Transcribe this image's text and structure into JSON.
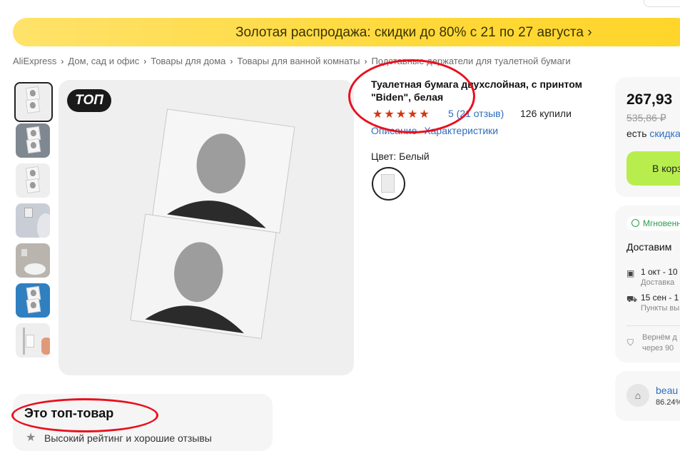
{
  "banner": {
    "text": "Золотая распродажа: скидки до 80% с 21 по 27 августа ›"
  },
  "breadcrumbs": [
    "AliExpress",
    "Дом, сад и офис",
    "Товары для дома",
    "Товары для ванной комнаты",
    "Подставные держатели для туалетной бумаги"
  ],
  "gallery": {
    "badge": "ТОП",
    "thumbnail_count": 7,
    "active_thumbnail": 1
  },
  "product": {
    "title": "Туалетная бумага двухслойная, с принтом \"Biden\", белая",
    "stars": "★★★★★",
    "rating_text": "5  (21 отзыв)",
    "sold_text": "126 купили",
    "links": [
      "Описание",
      "Характеристики"
    ],
    "color_label": "Цвет: Белый"
  },
  "price_card": {
    "price": "267,93",
    "old_price": "535,86 ₽",
    "discount_prefix": "есть",
    "discount_link": "скидка",
    "cart_button": "В корзину"
  },
  "delivery": {
    "badge": "Мгновенно",
    "title": "Доставим",
    "options": [
      {
        "icon": "box-icon",
        "main": "1 окт - 10",
        "sub": "Доставка"
      },
      {
        "icon": "truck-icon",
        "main": "15 сен - 1",
        "sub": "Пункты вы"
      }
    ],
    "return_line1": "Вернём д",
    "return_line2": "через 90"
  },
  "store": {
    "name": "beau",
    "rating": "86.24%"
  },
  "top_product": {
    "title": "Это топ-товар",
    "reason": "Высокий рейтинг и хорошие отзывы"
  },
  "annotation_color": "#e8101e"
}
